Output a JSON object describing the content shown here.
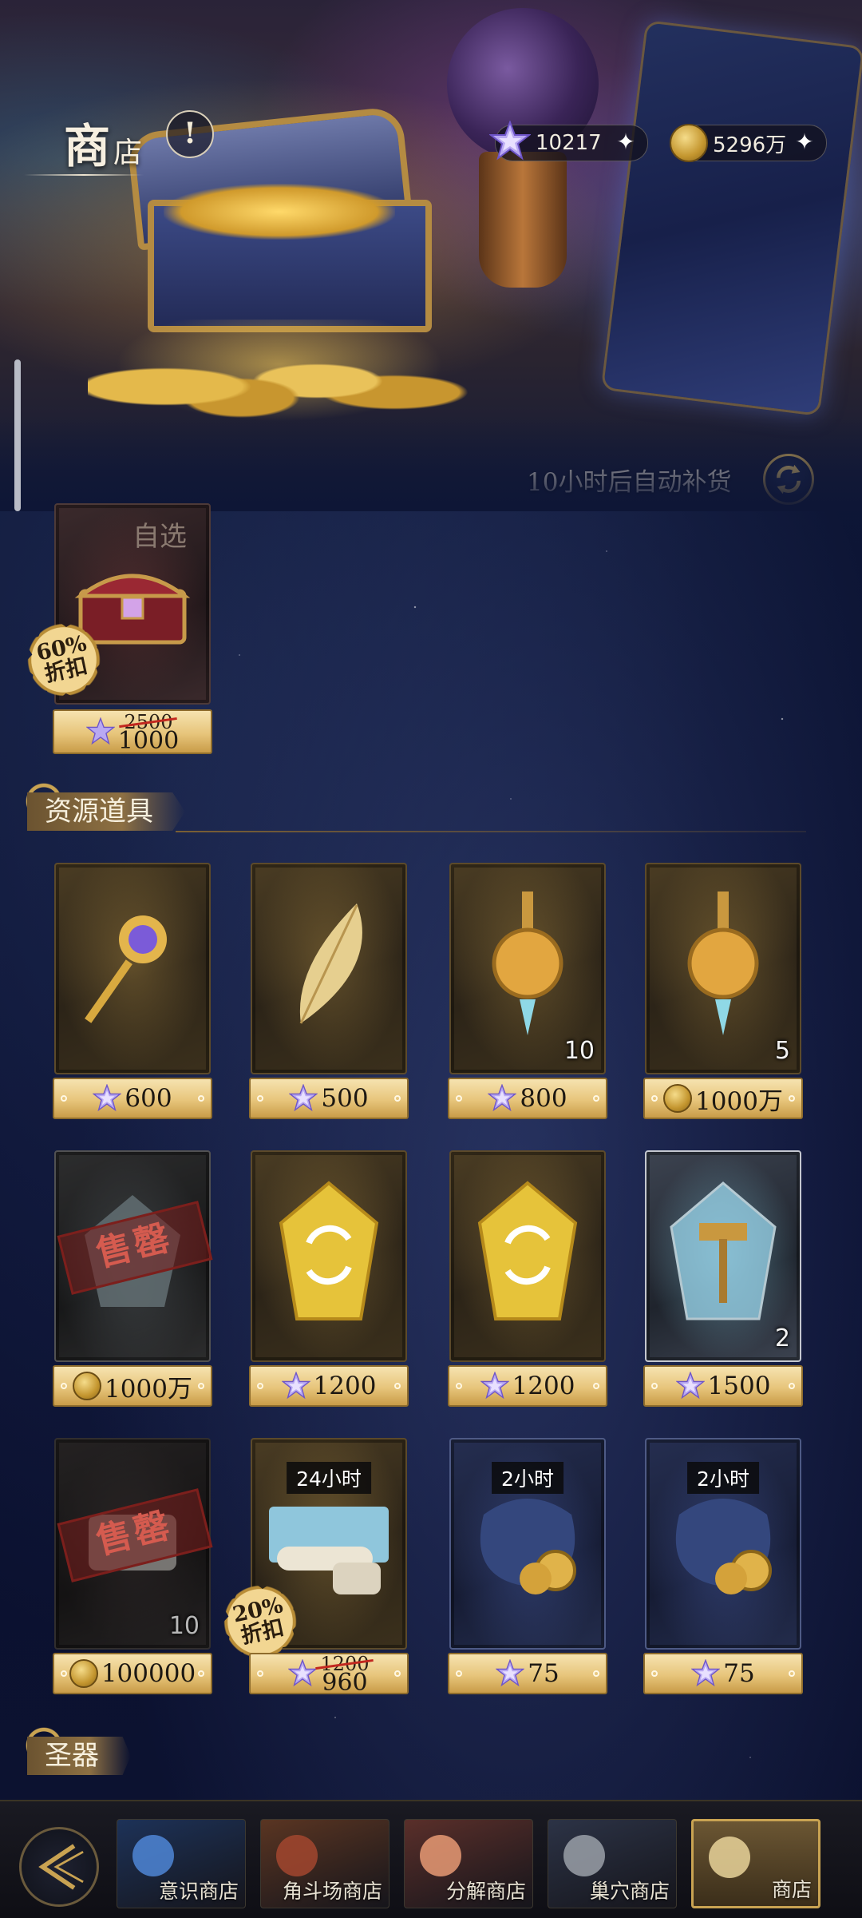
{
  "header": {
    "title_big": "商",
    "title_small": "店",
    "info_icon": "exclamation-icon"
  },
  "currency": {
    "gems": {
      "value": "10217",
      "icon": "star-gem-icon"
    },
    "coins": {
      "value": "5296万",
      "icon": "gold-coin-icon"
    }
  },
  "restock": {
    "text": "10小时后自动补货"
  },
  "featured": {
    "label": "自选",
    "discount": [
      "60%",
      "折扣"
    ],
    "price_old": "2500",
    "price_new": "1000",
    "currency": "gem"
  },
  "sections": {
    "resources": "资源道具",
    "artifacts": "圣器"
  },
  "items": [
    {
      "name": "key",
      "price": "600",
      "currency": "gem",
      "qty": "",
      "frame": "gold"
    },
    {
      "name": "feather",
      "price": "500",
      "currency": "gem",
      "qty": "",
      "frame": "gold"
    },
    {
      "name": "potion-a",
      "price": "800",
      "currency": "gem",
      "qty": "10",
      "frame": "gold"
    },
    {
      "name": "potion-b",
      "price": "1000万",
      "currency": "coin",
      "qty": "5",
      "frame": "gold"
    },
    {
      "name": "crystal-sold",
      "price": "1000万",
      "currency": "coin",
      "qty": "",
      "frame": "gray",
      "soldout": "售罄"
    },
    {
      "name": "exchange-crystal-a",
      "price": "1200",
      "currency": "gem",
      "qty": "",
      "frame": "gold"
    },
    {
      "name": "exchange-crystal-b",
      "price": "1200",
      "currency": "gem",
      "qty": "",
      "frame": "gold"
    },
    {
      "name": "hammer-crystal",
      "price": "1500",
      "currency": "gem",
      "qty": "2",
      "frame": "silver"
    },
    {
      "name": "scroll-sold",
      "price": "100000",
      "currency": "coin",
      "qty": "10",
      "frame": "red",
      "soldout": "售罄"
    },
    {
      "name": "scroll-pack",
      "price_old": "1200",
      "price": "960",
      "currency": "gem",
      "qty": "",
      "frame": "gold",
      "timer": "24小时",
      "discount": [
        "20%",
        "折扣"
      ]
    },
    {
      "name": "coin-bag-a",
      "price": "75",
      "currency": "gem",
      "qty": "",
      "frame": "blue",
      "timer": "2小时"
    },
    {
      "name": "coin-bag-b",
      "price": "75",
      "currency": "gem",
      "qty": "",
      "frame": "blue",
      "timer": "2小时"
    }
  ],
  "nav": {
    "tabs": [
      {
        "label": "意识商店",
        "icon": "shell-icon"
      },
      {
        "label": "角斗场商店",
        "icon": "shield-icon"
      },
      {
        "label": "分解商店",
        "icon": "flower-icon"
      },
      {
        "label": "巢穴商店",
        "icon": "egg-icon"
      },
      {
        "label": "商店",
        "icon": "scales-icon",
        "active": true
      }
    ]
  },
  "colors": {
    "gold": "#c9a352",
    "price_bar": "#e7c57b",
    "discount_strike": "#c2271f"
  }
}
